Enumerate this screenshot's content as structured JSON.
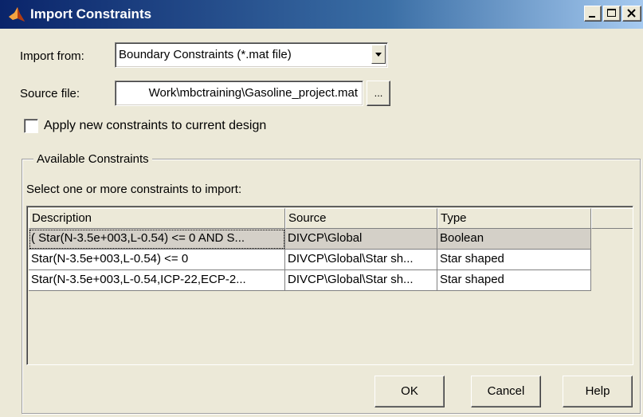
{
  "window": {
    "title": "Import Constraints"
  },
  "form": {
    "import_from_label": "Import from:",
    "import_from_value": "Boundary Constraints (*.mat file)",
    "source_file_label": "Source file:",
    "source_file_value": "Work\\mbctraining\\Gasoline_project.mat",
    "browse_label": "...",
    "apply_checkbox_label": "Apply new constraints to current design",
    "apply_checked": false
  },
  "group": {
    "title": "Available Constraints",
    "instruction": "Select one or more constraints to import:"
  },
  "table": {
    "columns": [
      "Description",
      "Source",
      "Type"
    ],
    "rows": [
      {
        "description": "( Star(N-3.5e+003,L-0.54) <= 0 AND S...",
        "source": "DIVCP\\Global",
        "type": "Boolean",
        "selected": true
      },
      {
        "description": "Star(N-3.5e+003,L-0.54) <= 0",
        "source": "DIVCP\\Global\\Star sh...",
        "type": "Star shaped",
        "selected": false
      },
      {
        "description": "Star(N-3.5e+003,L-0.54,ICP-22,ECP-2...",
        "source": "DIVCP\\Global\\Star sh...",
        "type": "Star shaped",
        "selected": false
      }
    ]
  },
  "buttons": {
    "ok": "OK",
    "cancel": "Cancel",
    "help": "Help"
  },
  "colors": {
    "titlebar_start": "#0a246a",
    "titlebar_end": "#a6caf0",
    "face": "#ece9d8"
  },
  "icons": {
    "app": "matlab-icon",
    "minimize": "minimize-icon",
    "maximize": "maximize-icon",
    "close": "close-icon",
    "dropdown": "chevron-down-icon"
  }
}
